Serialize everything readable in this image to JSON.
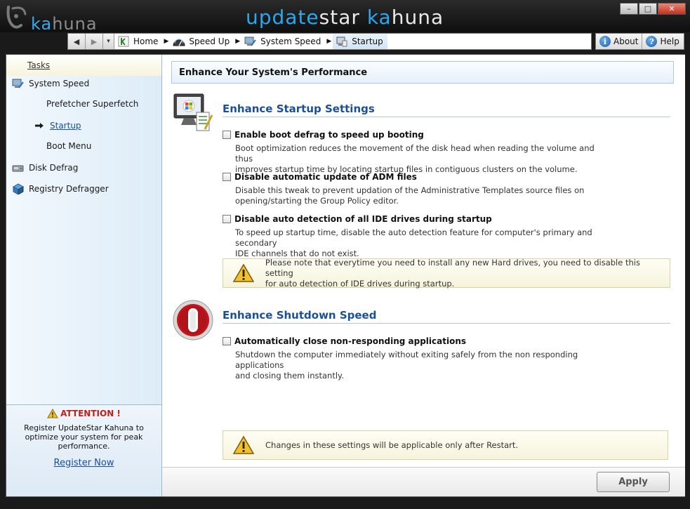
{
  "window": {
    "logo_text_k": "ka",
    "logo_text_rest": "huna",
    "title_update": "update",
    "title_star": "star",
    "title_k": "ka",
    "title_rest": "huna",
    "minimize_glyph": "–",
    "maximize_glyph": "□",
    "close_glyph": "✕"
  },
  "navbar": {
    "back_glyph": "◀",
    "forward_glyph": "▶",
    "dropdown_glyph": "▾",
    "separator_glyph": "▶",
    "crumbs": [
      {
        "label": "Home",
        "icon": "home-icon"
      },
      {
        "label": "Speed Up",
        "icon": "speedometer-icon"
      },
      {
        "label": "System Speed",
        "icon": "system-speed-icon"
      },
      {
        "label": "Startup",
        "icon": "startup-icon"
      }
    ],
    "about_label": "About",
    "help_label": "Help"
  },
  "sidebar": {
    "tasks_label": "Tasks",
    "items": [
      {
        "label": "System Speed",
        "icon": "system-speed-icon"
      },
      {
        "label": "Prefetcher Superfetch"
      },
      {
        "label": "Startup",
        "current": true
      },
      {
        "label": "Boot Menu"
      },
      {
        "label": "Disk Defrag",
        "icon": "disk-defrag-icon"
      },
      {
        "label": "Registry Defragger",
        "icon": "registry-icon"
      }
    ],
    "attention_title": "ATTENTION !",
    "attention_text": "Register UpdateStar Kahuna to optimize your system for peak performance.",
    "register_link": "Register Now"
  },
  "content": {
    "header": "Enhance Your System's Performance",
    "startup_section": {
      "title": "Enhance Startup Settings",
      "options": [
        {
          "label": "Enable boot defrag to speed up booting",
          "checked": false,
          "desc_line1": "Boot optimization reduces the movement of the disk head when reading the volume and thus",
          "desc_line2": "improves startup time by locating startup files in contiguous clusters on the volume."
        },
        {
          "label": "Disable automatic update of ADM files",
          "checked": false,
          "desc_line1": "Disable this tweak to prevent updation of the Administrative Templates source files on",
          "desc_line2": "opening/starting the Group Policy editor."
        },
        {
          "label": "Disable auto detection of all IDE drives during startup",
          "checked": false,
          "desc_line1": "To speed up startup time, disable the auto detection feature for computer's primary and secondary",
          "desc_line2": "IDE channels that do not exist."
        }
      ],
      "note_line1": "Please note that everytime you need to install any new Hard drives, you need to disable this setting",
      "note_line2": "for auto detection of IDE drives during startup."
    },
    "shutdown_section": {
      "title": "Enhance Shutdown Speed",
      "options": [
        {
          "label": "Automatically close non-responding applications",
          "checked": false,
          "desc_line1": "Shutdown the computer immediately without exiting safely from the non responding applications",
          "desc_line2": "and closing them instantly."
        }
      ]
    },
    "restart_note": "Changes in these settings will be applicable only after Restart.",
    "apply_label": "Apply"
  },
  "colors": {
    "accent_blue": "#1b4f9a",
    "link_blue": "#1a4fa0",
    "attention_red": "#c0201a",
    "title_blue": "#2aa8ee"
  }
}
